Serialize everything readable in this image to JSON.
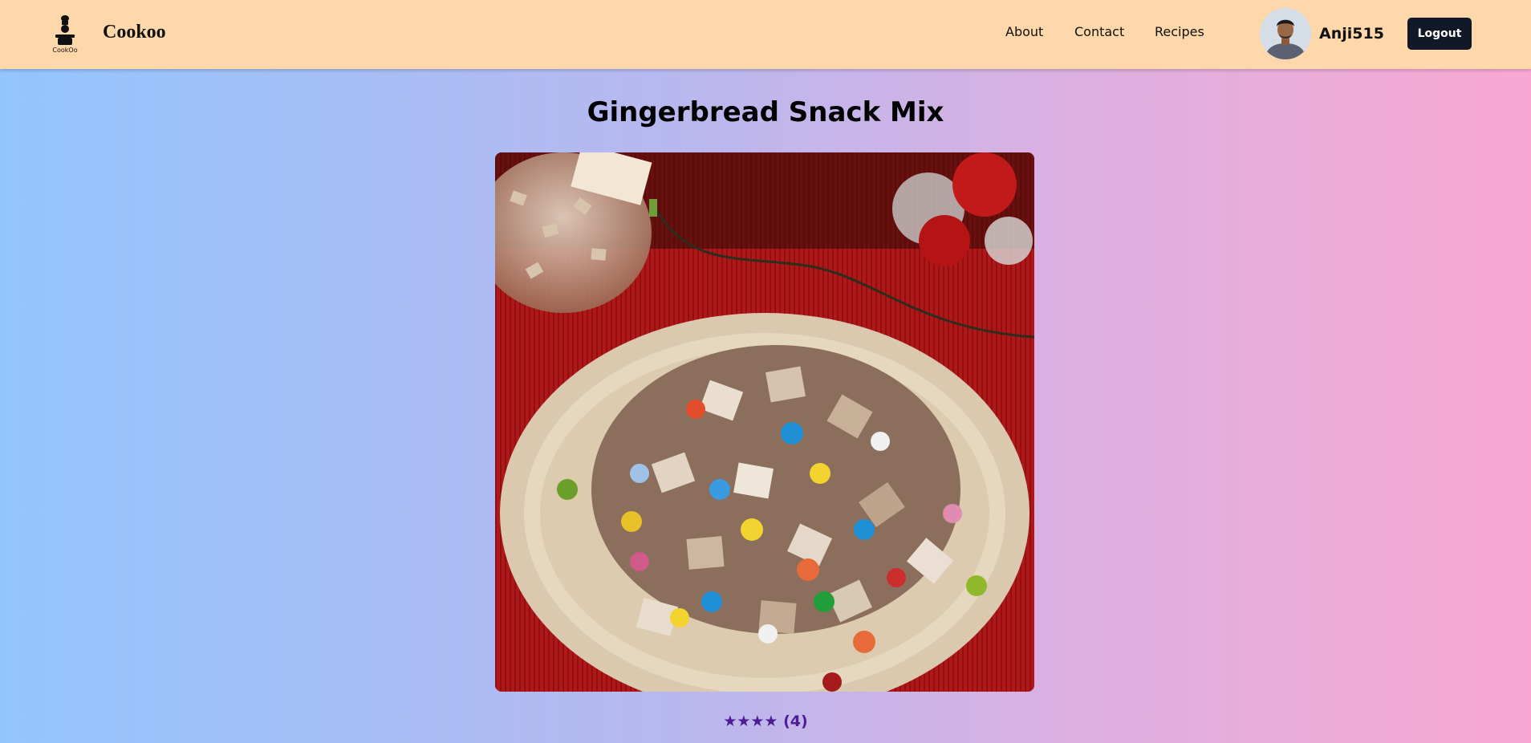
{
  "nav": {
    "logo_text": "CookOo",
    "brand": "Cookoo",
    "links": [
      "About",
      "Contact",
      "Recipes"
    ],
    "username": "Anji515",
    "logout_label": "Logout"
  },
  "recipe": {
    "title": "Gingerbread Snack Mix",
    "rating_stars": "★★★★",
    "rating_count": "(4)",
    "rating_value": 4
  },
  "colors": {
    "navbar": "#fed7aa",
    "logout_button": "#111827",
    "rating": "#4c1d95",
    "gradient_start": "#93c5fd",
    "gradient_end": "#f9a8d4"
  },
  "icons": {
    "logo": "chef-hat-icon",
    "avatar": "user-avatar"
  }
}
